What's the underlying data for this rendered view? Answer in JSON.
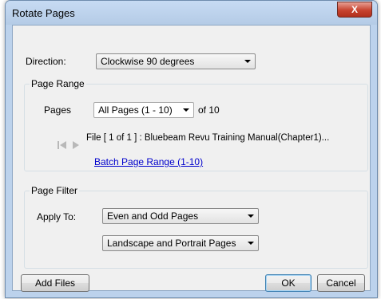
{
  "window": {
    "title": "Rotate Pages",
    "close_glyph": "X"
  },
  "direction": {
    "label": "Direction:",
    "value": "Clockwise 90 degrees"
  },
  "page_range": {
    "group_title": "Page Range",
    "pages_label": "Pages",
    "pages_value": "All Pages (1 - 10)",
    "of_text": "of 10",
    "file_text": "File [ 1 of 1 ] :  Bluebeam Revu Training Manual(Chapter1)...",
    "batch_link": "Batch Page Range (1-10)"
  },
  "page_filter": {
    "group_title": "Page Filter",
    "apply_label": "Apply To:",
    "apply_value": "Even and Odd Pages",
    "orientation_value": "Landscape and Portrait Pages"
  },
  "buttons": {
    "add_files": "Add Files",
    "ok": "OK",
    "cancel": "Cancel"
  },
  "icons": {
    "first_page": "skip-back-icon",
    "next_page": "play-icon"
  }
}
